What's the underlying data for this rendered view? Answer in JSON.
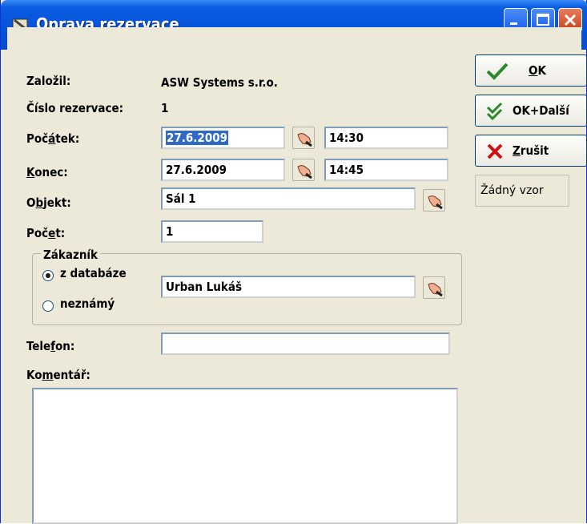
{
  "window": {
    "title": "Oprava rezervace"
  },
  "form": {
    "zalozil_label": "Založil:",
    "zalozil_value": "ASW Systems s.r.o.",
    "cislo_label": "Číslo rezervace:",
    "cislo_value": "1",
    "pocatek_label": "Počátek:",
    "pocatek_date": "27.6.2009",
    "pocatek_time": "14:30",
    "konec_label": "Konec:",
    "konec_date": "27.6.2009",
    "konec_time": "14:45",
    "objekt_label": "Objekt:",
    "objekt_value": "Sál 1",
    "pocet_label": "Počet:",
    "pocet_value": "1",
    "zakaznik": {
      "group_title": "Zákazník",
      "radio_db_label": "z databáze",
      "radio_unknown_label": "neznámý",
      "selected": "z databáze",
      "customer_value": "Urban Lukáš"
    },
    "telefon_label": "Telefon:",
    "telefon_value": "",
    "komentar_label": "Komentář:",
    "komentar_value": ""
  },
  "buttons": {
    "ok": "OK",
    "ok_next": "OK+Další",
    "cancel": "Zrušit",
    "template": "Žádný vzor"
  },
  "icons": {
    "title": "app-icon",
    "pick": "hand-pointer-icon",
    "ok": "checkmark-icon",
    "ok_next": "double-checkmark-icon",
    "cancel": "red-x-icon"
  },
  "colors": {
    "titlebar": "#0552d8",
    "face": "#ECE9D8",
    "selection": "#316ac5"
  }
}
